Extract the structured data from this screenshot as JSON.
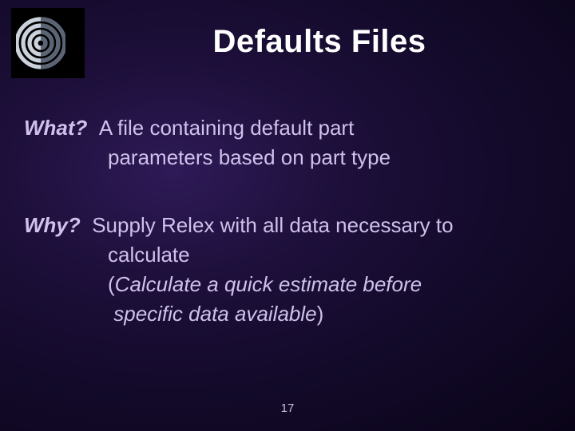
{
  "title": "Defaults Files",
  "what": {
    "label": "What?",
    "line1_rest": "A file containing default part",
    "line2": "parameters based on part type"
  },
  "why": {
    "label": "Why?",
    "line1_rest": "Supply Relex with all data necessary to",
    "line2": "calculate",
    "line3_open": "(",
    "line3_em": "Calculate a quick estimate before",
    "line4_em": "specific data available",
    "line4_close": ")"
  },
  "page_number": "17"
}
